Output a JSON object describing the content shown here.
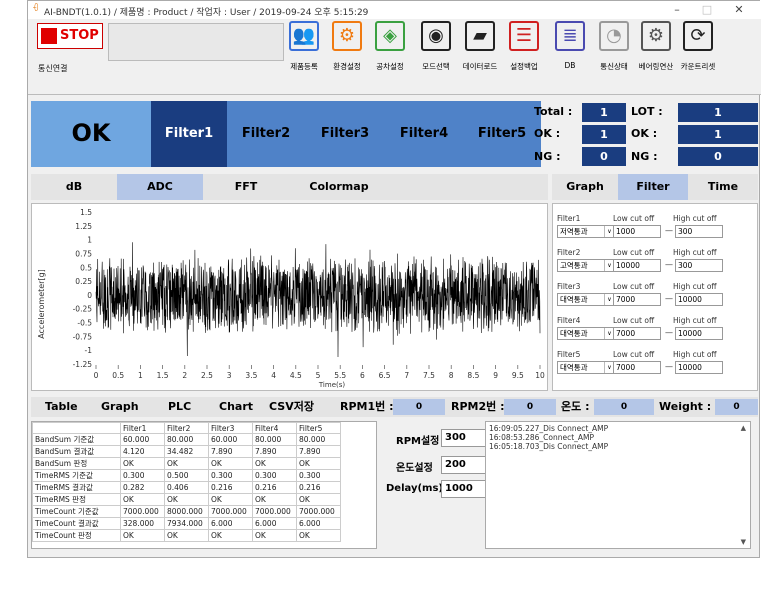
{
  "window": {
    "title": "AI-BNDT(1.0.1) / 제품명 : Product  / 작업자 : User / 2019-09-24 오후 5:15:29",
    "minimize": "–",
    "maximize": "□",
    "close": "✕"
  },
  "toolbar": {
    "stop_label": "STOP",
    "connect_label": "통신연결",
    "tools": [
      {
        "label": "제품등록",
        "icon": "people-icon",
        "color": "#3a6fd8"
      },
      {
        "label": "환경설정",
        "icon": "gears-icon",
        "color": "#f07a10"
      },
      {
        "label": "공차설정",
        "icon": "cube-icon",
        "color": "#3aa040"
      },
      {
        "label": "모드선택",
        "icon": "eye-icon",
        "color": "#222222"
      },
      {
        "label": "데이터로드",
        "icon": "folder-icon",
        "color": "#222222"
      },
      {
        "label": "설정백업",
        "icon": "database-icon",
        "color": "#d02020"
      },
      {
        "label": "DB",
        "icon": "db-list-icon",
        "color": "#4a4ab0"
      },
      {
        "label": "통신상태",
        "icon": "signal-icon",
        "color": "#999999"
      },
      {
        "label": "베어링연산",
        "icon": "bearing-icon",
        "color": "#555555"
      },
      {
        "label": "카운트리셋",
        "icon": "refresh-icon",
        "color": "#222222"
      }
    ]
  },
  "result": {
    "status": "OK"
  },
  "filters": [
    "Filter1",
    "Filter2",
    "Filter3",
    "Filter4",
    "Filter5"
  ],
  "stats": {
    "total_label": "Total :",
    "total_value": "1",
    "lot_label": "LOT :",
    "lot_value": "1",
    "ok_label": "OK :",
    "ok_value": "1",
    "ok2_label": "OK :",
    "ok2_value": "1",
    "ng_label": "NG :",
    "ng_value": "0",
    "ng2_label": "NG :",
    "ng2_value": "0"
  },
  "view_tabs": [
    "dB",
    "ADC",
    "FFT",
    "Colormap"
  ],
  "side_tabs": [
    "Graph",
    "Filter",
    "Time"
  ],
  "chart_data": {
    "type": "line",
    "ylabel": "Accelerometer[g]",
    "xlabel": "Time(s)",
    "xlim": [
      0,
      10
    ],
    "ylim": [
      -1.25,
      1.5
    ],
    "x_ticks": [
      "0",
      "0.5",
      "1",
      "1.5",
      "2",
      "2.5",
      "3",
      "3.5",
      "4",
      "4.5",
      "5",
      "5.5",
      "6",
      "6.5",
      "7",
      "7.5",
      "8",
      "8.5",
      "9",
      "9.5",
      "10"
    ],
    "y_ticks": [
      "1.5",
      "1.25",
      "1",
      "0.75",
      "0.5",
      "0.25",
      "0",
      "-0.25",
      "-0.5",
      "-0.75",
      "-1",
      "-1.25"
    ],
    "signal_amplitude": 0.75,
    "signal_color": "#000000"
  },
  "filter_panel": [
    {
      "name": "Filter1",
      "type": "저역통과",
      "low_label": "Low cut off",
      "high_label": "High cut off",
      "low": "1000",
      "high": "300"
    },
    {
      "name": "Filter2",
      "type": "고역통과",
      "low_label": "Low cut off",
      "high_label": "High cut off",
      "low": "10000",
      "high": "300"
    },
    {
      "name": "Filter3",
      "type": "대역통과",
      "low_label": "Low cut off",
      "high_label": "High cut off",
      "low": "7000",
      "high": "10000"
    },
    {
      "name": "Filter4",
      "type": "대역통과",
      "low_label": "Low cut off",
      "high_label": "High cut off",
      "low": "7000",
      "high": "10000"
    },
    {
      "name": "Filter5",
      "type": "대역통과",
      "low_label": "Low cut off",
      "high_label": "High cut off",
      "low": "7000",
      "high": "10000"
    }
  ],
  "bottom_bar": {
    "tabs": [
      "Table",
      "Graph",
      "PLC",
      "Chart",
      "CSV저장"
    ],
    "rpm1_label": "RPM1번 :",
    "rpm1_value": "0",
    "rpm2_label": "RPM2번 :",
    "rpm2_value": "0",
    "temp_label": "온도 :",
    "temp_value": "0",
    "weight_label": "Weight :",
    "weight_value": "0"
  },
  "table": {
    "headers": [
      "",
      "Filter1",
      "Filter2",
      "Filter3",
      "Filter4",
      "Filter5"
    ],
    "rows": [
      [
        "BandSum 기준값",
        "60.000",
        "80.000",
        "60.000",
        "80.000",
        "80.000"
      ],
      [
        "BandSum 결과값",
        "4.120",
        "34.482",
        "7.890",
        "7.890",
        "7.890"
      ],
      [
        "BandSum 판정",
        "OK",
        "OK",
        "OK",
        "OK",
        "OK"
      ],
      [
        "TimeRMS 기준값",
        "0.300",
        "0.500",
        "0.300",
        "0.300",
        "0.300"
      ],
      [
        "TimeRMS 결과값",
        "0.282",
        "0.406",
        "0.216",
        "0.216",
        "0.216"
      ],
      [
        "TimeRMS 판정",
        "OK",
        "OK",
        "OK",
        "OK",
        "OK"
      ],
      [
        "TimeCount 기준값",
        "7000.000",
        "8000.000",
        "7000.000",
        "7000.000",
        "7000.000"
      ],
      [
        "TimeCount 결과값",
        "328.000",
        "7934.000",
        "6.000",
        "6.000",
        "6.000"
      ],
      [
        "TimeCount 판정",
        "OK",
        "OK",
        "OK",
        "OK",
        "OK"
      ]
    ]
  },
  "settings": {
    "rpm_label": "RPM설정",
    "rpm_value": "300",
    "temp_label": "온도설정",
    "temp_value": "200",
    "delay_label": "Delay(ms)",
    "delay_value": "1000"
  },
  "log": [
    "16:09:05.227_Dis Connect_AMP",
    "16:08:53.286_Connect_AMP",
    "16:05:18.703_Dis Connect_AMP"
  ]
}
